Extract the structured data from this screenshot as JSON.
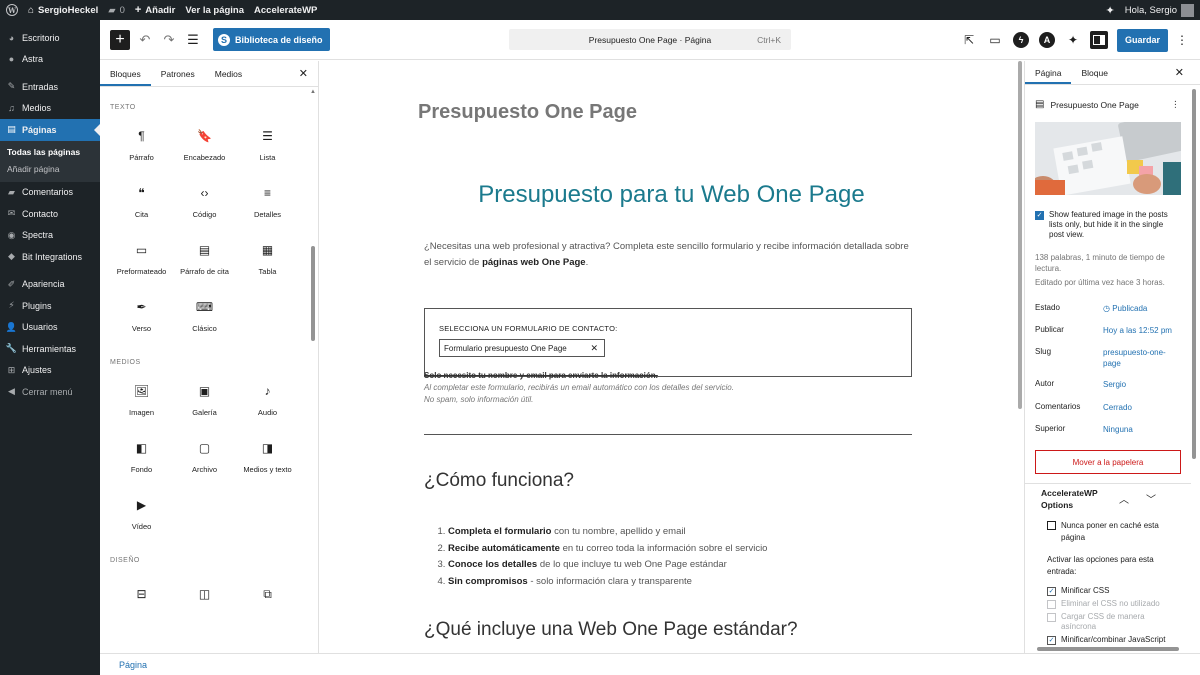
{
  "adminbar": {
    "site_name": "SergioHeckel",
    "comments_count": "0",
    "new_label": "Añadir",
    "view_page": "Ver la página",
    "plugin": "AccelerateWP",
    "greeting": "Hola, Sergio"
  },
  "sidebar": {
    "items": [
      {
        "label": "Escritorio",
        "icon": "dashboard-icon"
      },
      {
        "label": "Astra",
        "icon": "astra-icon"
      },
      {
        "label": "Entradas",
        "icon": "pin-icon"
      },
      {
        "label": "Medios",
        "icon": "media-icon"
      },
      {
        "label": "Páginas",
        "icon": "pages-icon"
      },
      {
        "label": "Comentarios",
        "icon": "comments-icon"
      },
      {
        "label": "Contacto",
        "icon": "mail-icon"
      },
      {
        "label": "Spectra",
        "icon": "spectra-icon"
      },
      {
        "label": "Bit Integrations",
        "icon": "integrations-icon"
      },
      {
        "label": "Apariencia",
        "icon": "appearance-icon"
      },
      {
        "label": "Plugins",
        "icon": "plugins-icon"
      },
      {
        "label": "Usuarios",
        "icon": "users-icon"
      },
      {
        "label": "Herramientas",
        "icon": "tools-icon"
      },
      {
        "label": "Ajustes",
        "icon": "settings-icon"
      },
      {
        "label": "Cerrar menú",
        "icon": "collapse-icon"
      }
    ],
    "submenu": [
      "Todas las páginas",
      "Añadir página"
    ]
  },
  "header": {
    "library_label": "Biblioteca de diseño",
    "command_title": "Presupuesto One Page · Página",
    "shortcut": "Ctrl+K",
    "save_label": "Guardar"
  },
  "inserter": {
    "tabs": [
      "Bloques",
      "Patrones",
      "Medios"
    ],
    "sections": [
      {
        "title": "TEXTO",
        "blocks": [
          {
            "label": "Párrafo",
            "icon": "¶"
          },
          {
            "label": "Encabezado",
            "icon": "🔖"
          },
          {
            "label": "Lista",
            "icon": "☰"
          },
          {
            "label": "Cita",
            "icon": "❝"
          },
          {
            "label": "Código",
            "icon": "‹›"
          },
          {
            "label": "Detalles",
            "icon": "≡"
          },
          {
            "label": "Preformateado",
            "icon": "▭"
          },
          {
            "label": "Párrafo de cita",
            "icon": "▤"
          },
          {
            "label": "Tabla",
            "icon": "▦"
          },
          {
            "label": "Verso",
            "icon": "✒"
          },
          {
            "label": "Clásico",
            "icon": "⌨"
          }
        ]
      },
      {
        "title": "MEDIOS",
        "blocks": [
          {
            "label": "Imagen",
            "icon": "🖼"
          },
          {
            "label": "Galería",
            "icon": "▣"
          },
          {
            "label": "Audio",
            "icon": "♪"
          },
          {
            "label": "Fondo",
            "icon": "◧"
          },
          {
            "label": "Archivo",
            "icon": "▢"
          },
          {
            "label": "Medios y texto",
            "icon": "◨"
          },
          {
            "label": "Vídeo",
            "icon": "▶"
          }
        ]
      },
      {
        "title": "DISEÑO",
        "blocks": [
          {
            "label": "",
            "icon": "⊟"
          },
          {
            "label": "",
            "icon": "◫"
          },
          {
            "label": "",
            "icon": "⧉"
          }
        ]
      }
    ]
  },
  "content": {
    "page_title": "Presupuesto One Page",
    "heading": "Presupuesto para tu Web One Page",
    "intro_pre": "¿Necesitas una web profesional y atractiva? Completa este sencillo formulario y recibe información detallada sobre el servicio de ",
    "intro_bold": "páginas web One Page",
    "intro_post": ".",
    "form_label": "SELECCIONA UN FORMULARIO DE CONTACTO:",
    "form_value": "Formulario presupuesto One Page",
    "note1": "Solo necesito tu nombre y email para enviarte la información.",
    "note2": "Al completar este formulario, recibirás un email automático con los detalles del servicio.",
    "note3": "No spam, solo información útil.",
    "h2_how": "¿Cómo funciona?",
    "steps": [
      {
        "bold": "Completa el formulario",
        "rest": " con tu nombre, apellido y email"
      },
      {
        "bold": "Recibe automáticamente",
        "rest": " en tu correo toda la información sobre el servicio"
      },
      {
        "bold": "Conoce los detalles",
        "rest": " de lo que incluye tu web One Page estándar"
      },
      {
        "bold": "Sin compromisos",
        "rest": " - solo información clara y transparente"
      }
    ],
    "h2_what": "¿Qué incluye una Web One Page estándar?"
  },
  "settings": {
    "tabs": [
      "Página",
      "Bloque"
    ],
    "doc_title": "Presupuesto One Page",
    "featured_checkbox": "Show featured image in the posts lists only, but hide it in the single post view.",
    "word_info": "138 palabras, 1 minuto de tiempo de lectura.",
    "edited": "Editado por última vez hace 3 horas.",
    "props": [
      {
        "k": "Estado",
        "v": "Publicada"
      },
      {
        "k": "Publicar",
        "v": "Hoy a las 12:52 pm"
      },
      {
        "k": "Slug",
        "v": "presupuesto-one-page"
      },
      {
        "k": "Autor",
        "v": "Sergio"
      },
      {
        "k": "Comentarios",
        "v": "Cerrado"
      },
      {
        "k": "Superior",
        "v": "Ninguna"
      }
    ],
    "trash_label": "Mover a la papelera",
    "accel_title": "AccelerateWP Options",
    "never_cache": "Nunca poner en caché esta página",
    "activate_label": "Activar las opciones para esta entrada:",
    "opt_minify_css": "Minificar CSS",
    "opt_remove_css": "Eliminar el CSS no utilizado",
    "opt_async_css": "Cargar CSS de manera asíncrona",
    "opt_minify_js": "Minificar/combinar JavaScript"
  },
  "footer": {
    "breadcrumb": "Página"
  }
}
